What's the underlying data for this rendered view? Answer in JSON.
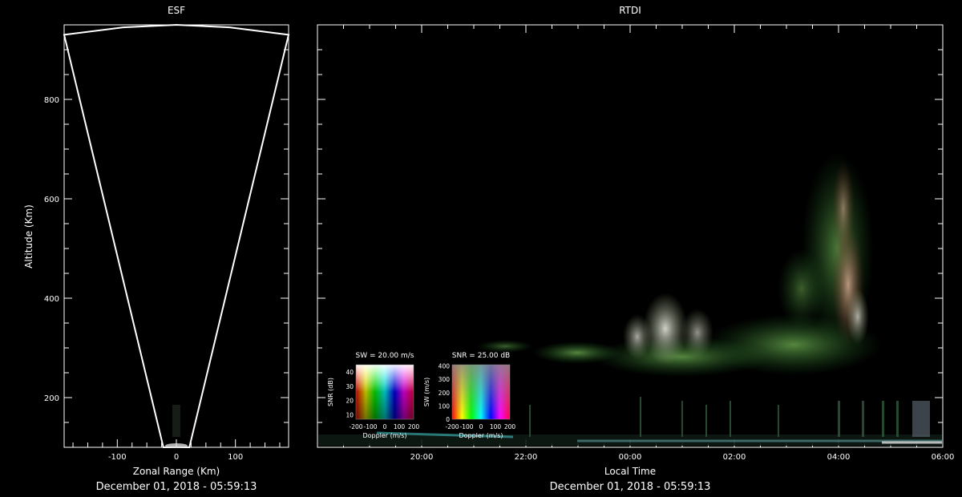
{
  "chart_data": [
    {
      "id": "esf",
      "type": "scatter",
      "title": "ESF",
      "xlabel": "Zonal Range (Km)",
      "ylabel": "Altitude (Km)",
      "footer": "December 01, 2018 - 05:59:13",
      "xlim": [
        -190,
        190
      ],
      "ylim": [
        100,
        950
      ],
      "xticks": [
        -100,
        0,
        100
      ],
      "yticks": [
        200,
        400,
        600,
        800
      ],
      "beam_outline": [
        [
          -190,
          930
        ],
        [
          -90,
          945
        ],
        [
          0,
          950
        ],
        [
          90,
          945
        ],
        [
          190,
          930
        ],
        [
          22,
          100
        ],
        [
          -22,
          100
        ]
      ]
    },
    {
      "id": "rtdi",
      "type": "heatmap",
      "title": "RTDI",
      "xlabel": "Local Time",
      "footer": "December 01, 2018 - 05:59:13",
      "xlim": [
        "18:00",
        "06:00"
      ],
      "ylim": [
        100,
        950
      ],
      "xticks": [
        "20:00",
        "22:00",
        "00:00",
        "02:00",
        "04:00",
        "06:00"
      ],
      "echo_regions": [
        {
          "t_start": "22:30",
          "t_end": "05:30",
          "alt_base": 250,
          "alt_top": 330,
          "tone": "green"
        },
        {
          "t_start": "23:30",
          "t_end": "01:00",
          "alt_base": 260,
          "alt_top": 360,
          "tone": "white"
        },
        {
          "t_start": "03:30",
          "t_end": "04:45",
          "alt_base": 280,
          "alt_top": 690,
          "tone": "red-white"
        }
      ],
      "legends": [
        {
          "id": "legend-sw",
          "title": "SW = 20.00 m/s",
          "xlabel": "Doppler (m/s)",
          "ylabel": "SNR (dB)",
          "xticks": [
            "-200",
            "-100",
            "0",
            "100",
            "200"
          ],
          "yticks": [
            "10",
            "20",
            "30",
            "40"
          ]
        },
        {
          "id": "legend-snr",
          "title": "SNR = 25.00 dB",
          "xlabel": "Doppler (m/s)",
          "ylabel": "SW (m/s)",
          "xticks": [
            "-200",
            "-100",
            "0",
            "100",
            "200"
          ],
          "yticks": [
            "0",
            "100",
            "200",
            "300",
            "400"
          ]
        }
      ]
    }
  ]
}
